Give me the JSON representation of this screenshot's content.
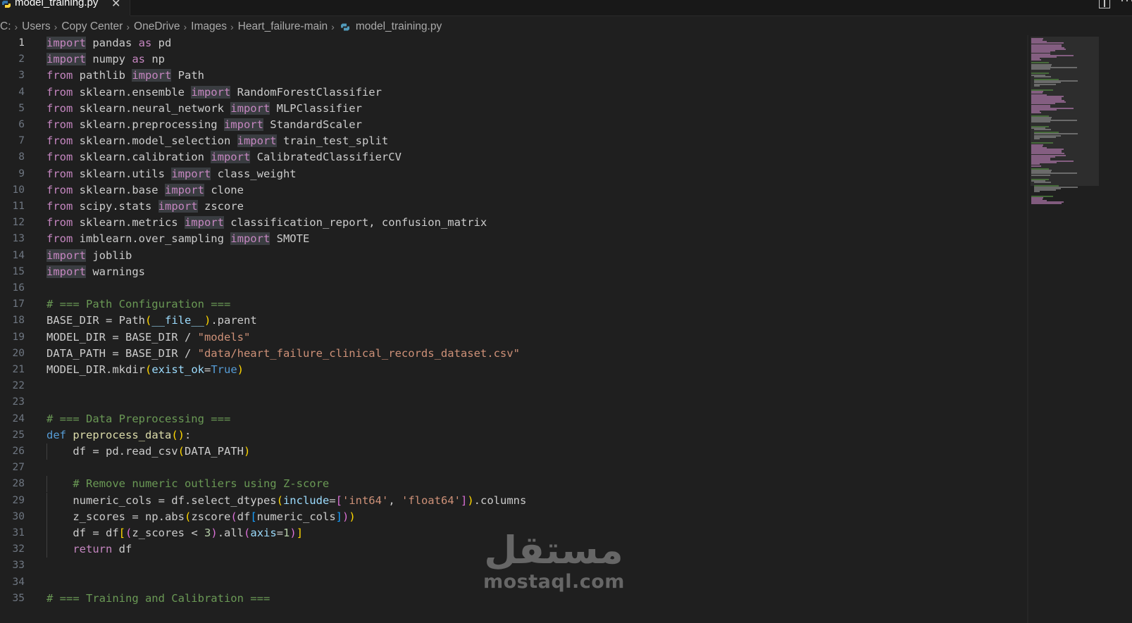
{
  "tab": {
    "filename": "model_training.py",
    "close_glyph": "✕"
  },
  "breadcrumb": {
    "items": [
      "C:",
      "Users",
      "Copy Center",
      "OneDrive",
      "Images",
      "Heart_failure-main"
    ],
    "file": "model_training.py"
  },
  "editor": {
    "active_line": 1,
    "lines": [
      [
        [
          "imp",
          "import"
        ],
        [
          "t",
          " pandas "
        ],
        [
          "kw",
          "as"
        ],
        [
          "t",
          " pd"
        ]
      ],
      [
        [
          "imp",
          "import"
        ],
        [
          "t",
          " numpy "
        ],
        [
          "kw",
          "as"
        ],
        [
          "t",
          " np"
        ]
      ],
      [
        [
          "kw",
          "from"
        ],
        [
          "t",
          " pathlib "
        ],
        [
          "imp",
          "import"
        ],
        [
          "t",
          " Path"
        ]
      ],
      [
        [
          "kw",
          "from"
        ],
        [
          "t",
          " sklearn.ensemble "
        ],
        [
          "imp",
          "import"
        ],
        [
          "t",
          " RandomForestClassifier"
        ]
      ],
      [
        [
          "kw",
          "from"
        ],
        [
          "t",
          " sklearn.neural_network "
        ],
        [
          "imp",
          "import"
        ],
        [
          "t",
          " MLPClassifier"
        ]
      ],
      [
        [
          "kw",
          "from"
        ],
        [
          "t",
          " sklearn.preprocessing "
        ],
        [
          "imp",
          "import"
        ],
        [
          "t",
          " StandardScaler"
        ]
      ],
      [
        [
          "kw",
          "from"
        ],
        [
          "t",
          " sklearn.model_selection "
        ],
        [
          "imp",
          "import"
        ],
        [
          "t",
          " train_test_split"
        ]
      ],
      [
        [
          "kw",
          "from"
        ],
        [
          "t",
          " sklearn.calibration "
        ],
        [
          "imp",
          "import"
        ],
        [
          "t",
          " CalibratedClassifierCV"
        ]
      ],
      [
        [
          "kw",
          "from"
        ],
        [
          "t",
          " sklearn.utils "
        ],
        [
          "imp",
          "import"
        ],
        [
          "t",
          " class_weight"
        ]
      ],
      [
        [
          "kw",
          "from"
        ],
        [
          "t",
          " sklearn.base "
        ],
        [
          "imp",
          "import"
        ],
        [
          "t",
          " clone"
        ]
      ],
      [
        [
          "kw",
          "from"
        ],
        [
          "t",
          " scipy.stats "
        ],
        [
          "imp",
          "import"
        ],
        [
          "t",
          " zscore"
        ]
      ],
      [
        [
          "kw",
          "from"
        ],
        [
          "t",
          " sklearn.metrics "
        ],
        [
          "imp",
          "import"
        ],
        [
          "t",
          " classification_report, confusion_matrix"
        ]
      ],
      [
        [
          "kw",
          "from"
        ],
        [
          "t",
          " imblearn.over_sampling "
        ],
        [
          "imp",
          "import"
        ],
        [
          "t",
          " SMOTE"
        ]
      ],
      [
        [
          "imp",
          "import"
        ],
        [
          "t",
          " joblib"
        ]
      ],
      [
        [
          "imp",
          "import"
        ],
        [
          "t",
          " warnings"
        ]
      ],
      [],
      [
        [
          "cmt",
          "# === Path Configuration ==="
        ]
      ],
      [
        [
          "t",
          "BASE_DIR = Path"
        ],
        [
          "p1",
          "("
        ],
        [
          "dunder",
          "__file__"
        ],
        [
          "p1",
          ")"
        ],
        [
          "t",
          ".parent"
        ]
      ],
      [
        [
          "t",
          "MODEL_DIR = BASE_DIR / "
        ],
        [
          "str",
          "\"models\""
        ]
      ],
      [
        [
          "t",
          "DATA_PATH = BASE_DIR / "
        ],
        [
          "str",
          "\"data/heart_failure_clinical_records_dataset.csv\""
        ]
      ],
      [
        [
          "t",
          "MODEL_DIR.mkdir"
        ],
        [
          "p1",
          "("
        ],
        [
          "param",
          "exist_ok"
        ],
        [
          "t",
          "="
        ],
        [
          "const",
          "True"
        ],
        [
          "p1",
          ")"
        ]
      ],
      [],
      [],
      [
        [
          "cmt",
          "# === Data Preprocessing ==="
        ]
      ],
      [
        [
          "def",
          "def"
        ],
        [
          "t",
          " "
        ],
        [
          "fn",
          "preprocess_data"
        ],
        [
          "p1",
          "()"
        ],
        [
          "t",
          ":"
        ]
      ],
      [
        [
          "t",
          "    df = pd.read_csv"
        ],
        [
          "p1",
          "("
        ],
        [
          "t",
          "DATA_PATH"
        ],
        [
          "p1",
          ")"
        ]
      ],
      [],
      [
        [
          "t",
          "    "
        ],
        [
          "cmt",
          "# Remove numeric outliers using Z-score"
        ]
      ],
      [
        [
          "t",
          "    numeric_cols = df.select_dtypes"
        ],
        [
          "p1",
          "("
        ],
        [
          "param",
          "include"
        ],
        [
          "t",
          "="
        ],
        [
          "p2",
          "["
        ],
        [
          "str",
          "'int64'"
        ],
        [
          "t",
          ", "
        ],
        [
          "str",
          "'float64'"
        ],
        [
          "p2",
          "]"
        ],
        [
          "p1",
          ")"
        ],
        [
          "t",
          ".columns"
        ]
      ],
      [
        [
          "t",
          "    z_scores = np.abs"
        ],
        [
          "p1",
          "("
        ],
        [
          "t",
          "zscore"
        ],
        [
          "p2",
          "("
        ],
        [
          "t",
          "df"
        ],
        [
          "p3",
          "["
        ],
        [
          "t",
          "numeric_cols"
        ],
        [
          "p3",
          "]"
        ],
        [
          "p2",
          ")"
        ],
        [
          "p1",
          ")"
        ]
      ],
      [
        [
          "t",
          "    df = df"
        ],
        [
          "p1",
          "["
        ],
        [
          "p2",
          "("
        ],
        [
          "t",
          "z_scores < "
        ],
        [
          "num",
          "3"
        ],
        [
          "p2",
          ")"
        ],
        [
          "t",
          ".all"
        ],
        [
          "p2",
          "("
        ],
        [
          "param",
          "axis"
        ],
        [
          "t",
          "="
        ],
        [
          "num",
          "1"
        ],
        [
          "p2",
          ")"
        ],
        [
          "p1",
          "]"
        ]
      ],
      [
        [
          "t",
          "    "
        ],
        [
          "kw",
          "return"
        ],
        [
          "t",
          " df"
        ]
      ],
      [],
      [],
      [
        [
          "cmt",
          "# === Training and Calibration ==="
        ]
      ]
    ]
  },
  "watermark": {
    "arabic": "مستقل",
    "latin": "mostaql.com"
  }
}
